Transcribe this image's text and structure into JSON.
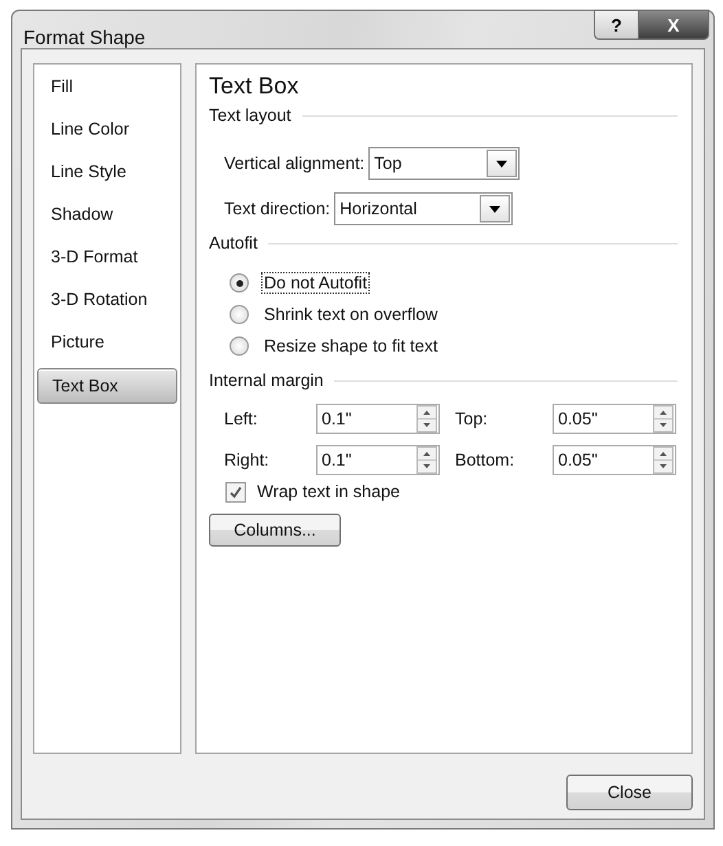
{
  "window": {
    "title": "Format Shape",
    "help_button": "?",
    "close_button": "X"
  },
  "sidebar": {
    "items": [
      {
        "label": "Fill",
        "selected": false
      },
      {
        "label": "Line Color",
        "selected": false
      },
      {
        "label": "Line Style",
        "selected": false
      },
      {
        "label": "Shadow",
        "selected": false
      },
      {
        "label": "3-D Format",
        "selected": false
      },
      {
        "label": "3-D Rotation",
        "selected": false
      },
      {
        "label": "Picture",
        "selected": false
      },
      {
        "label": "Text Box",
        "selected": true
      }
    ]
  },
  "panel": {
    "title": "Text Box",
    "text_layout": {
      "heading": "Text layout",
      "fields": [
        {
          "label": "Vertical alignment:",
          "value": "Top"
        },
        {
          "label": "Text direction:",
          "value": "Horizontal"
        }
      ]
    },
    "autofit": {
      "heading": "Autofit",
      "options": [
        {
          "label": "Do not Autofit",
          "selected": true,
          "focused": true
        },
        {
          "label": "Shrink text on overflow",
          "selected": false,
          "focused": false
        },
        {
          "label": "Resize shape to fit text",
          "selected": false,
          "focused": false
        }
      ]
    },
    "internal_margin": {
      "heading": "Internal margin",
      "spinners": [
        {
          "label": "Left:",
          "value": "0.1\""
        },
        {
          "label": "Top:",
          "value": "0.05\""
        },
        {
          "label": "Right:",
          "value": "0.1\""
        },
        {
          "label": "Bottom:",
          "value": "0.05\""
        }
      ],
      "wrap": {
        "label": "Wrap text in shape",
        "checked": true
      }
    },
    "columns_button": "Columns..."
  },
  "footer": {
    "close_button": "Close"
  }
}
